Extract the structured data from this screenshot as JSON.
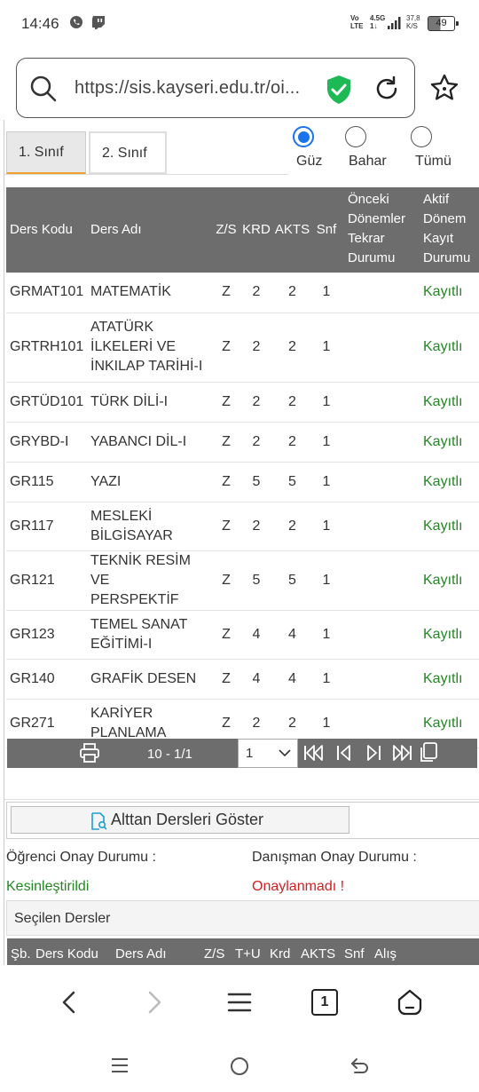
{
  "status": {
    "time": "14:46",
    "net_top": "Vo",
    "net_bottom": "LTE",
    "net2_top": "4.5G",
    "net2_bottom": "1↓",
    "speed_top": "37,8",
    "speed_bottom": "K/S",
    "battery": "49"
  },
  "browser": {
    "url": "https://sis.kayseri.edu.tr/oi..."
  },
  "tabs": [
    "1. Sınıf",
    "2. Sınıf"
  ],
  "semester": {
    "options": [
      "Güz",
      "Bahar",
      "Tümü"
    ],
    "selected": "Güz"
  },
  "table": {
    "headers": [
      "Ders Kodu",
      "Ders Adı",
      "Z/S",
      "KRD",
      "AKTS",
      "Snf",
      "Önceki Dönemler Tekrar Durumu",
      "Aktif Dönem Kayıt Durumu"
    ],
    "header_lines": {
      "onceki": [
        "Önceki",
        "Dönemler",
        "Tekrar",
        "Durumu"
      ],
      "aktif": [
        "Aktif",
        "Dönem",
        "Kayıt",
        "Durumu"
      ]
    },
    "rows": [
      {
        "code": "GRMAT101",
        "name": [
          "MATEMATİK"
        ],
        "zs": "Z",
        "krd": "2",
        "akts": "2",
        "snf": "1",
        "onceki": "",
        "aktif": "Kayıtlı"
      },
      {
        "code": "GRTRH101",
        "name": [
          "ATATÜRK",
          "İLKELERİ VE",
          "İNKILAP TARİHİ-I"
        ],
        "zs": "Z",
        "krd": "2",
        "akts": "2",
        "snf": "1",
        "onceki": "",
        "aktif": "Kayıtlı"
      },
      {
        "code": "GRTÜD101",
        "name": [
          "TÜRK DİLİ-I"
        ],
        "zs": "Z",
        "krd": "2",
        "akts": "2",
        "snf": "1",
        "onceki": "",
        "aktif": "Kayıtlı"
      },
      {
        "code": "GRYBD-I",
        "name": [
          "YABANCI DİL-I"
        ],
        "zs": "Z",
        "krd": "2",
        "akts": "2",
        "snf": "1",
        "onceki": "",
        "aktif": "Kayıtlı"
      },
      {
        "code": "GR115",
        "name": [
          "YAZI"
        ],
        "zs": "Z",
        "krd": "5",
        "akts": "5",
        "snf": "1",
        "onceki": "",
        "aktif": "Kayıtlı"
      },
      {
        "code": "GR117",
        "name": [
          "MESLEKİ",
          "BİLGİSAYAR"
        ],
        "zs": "Z",
        "krd": "2",
        "akts": "2",
        "snf": "1",
        "onceki": "",
        "aktif": "Kayıtlı"
      },
      {
        "code": "GR121",
        "name": [
          "TEKNİK RESİM VE",
          "PERSPEKTİF"
        ],
        "zs": "Z",
        "krd": "5",
        "akts": "5",
        "snf": "1",
        "onceki": "",
        "aktif": "Kayıtlı"
      },
      {
        "code": "GR123",
        "name": [
          "TEMEL SANAT",
          "EĞİTİMİ-I"
        ],
        "zs": "Z",
        "krd": "4",
        "akts": "4",
        "snf": "1",
        "onceki": "",
        "aktif": "Kayıtlı"
      },
      {
        "code": "GR140",
        "name": [
          "GRAFİK DESEN"
        ],
        "zs": "Z",
        "krd": "4",
        "akts": "4",
        "snf": "1",
        "onceki": "",
        "aktif": "Kayıtlı"
      },
      {
        "code": "GR271",
        "name": [
          "KARİYER",
          "PLANLAMA"
        ],
        "zs": "Z",
        "krd": "2",
        "akts": "2",
        "snf": "1",
        "onceki": "",
        "aktif": "Kayıtlı"
      }
    ]
  },
  "pager": {
    "count": "10 - 1/1",
    "page_select": "1"
  },
  "show_button": "Alttan Dersleri Göster",
  "approval": {
    "student_label": "Öğrenci Onay Durumu :",
    "student_value": "Kesinleştirildi",
    "advisor_label": "Danışman Onay Durumu :",
    "advisor_value": "Onaylanmadı !"
  },
  "selected_section": {
    "title": "Seçilen Dersler",
    "headers": [
      "Şb.",
      "Ders Kodu",
      "Ders Adı",
      "Z/S",
      "T+U",
      "Krd",
      "AKTS",
      "Snf",
      "Alış"
    ]
  },
  "bottom_nav": {
    "tabs_count": "1"
  },
  "colors": {
    "header_bg": "#6d6d6d",
    "registered": "#228822",
    "not_approved": "#d02020",
    "radio_accent": "#1a73e8",
    "shield": "#1db954",
    "tab_accent": "#f0a030"
  }
}
